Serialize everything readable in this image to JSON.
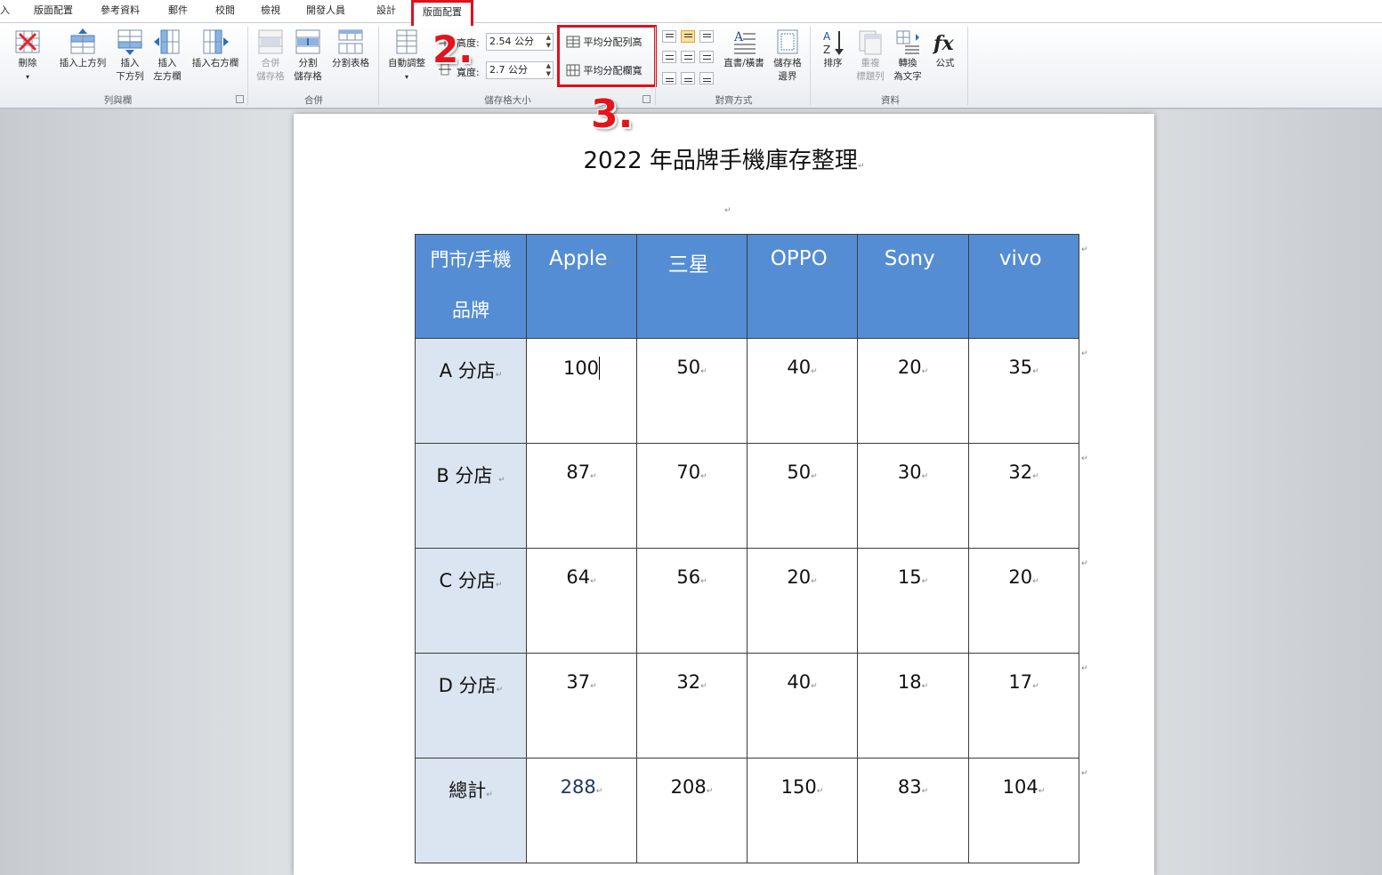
{
  "tabs": [
    {
      "label": "入"
    },
    {
      "label": "版面配置"
    },
    {
      "label": "參考資料"
    },
    {
      "label": "郵件"
    },
    {
      "label": "校閱"
    },
    {
      "label": "檢視"
    },
    {
      "label": "開發人員"
    },
    {
      "label": "設計"
    },
    {
      "label": "版面配置",
      "active": true
    }
  ],
  "ribbon": {
    "rows_cols": {
      "delete": "刪除",
      "insert_above": "插入上方列",
      "insert_below_1": "插入",
      "insert_below_2": "下方列",
      "insert_left_1": "插入",
      "insert_left_2": "左方欄",
      "insert_right": "插入右方欄",
      "label": "列與欄"
    },
    "merge": {
      "merge_cells_1": "合併",
      "merge_cells_2": "儲存格",
      "split_cells_1": "分割",
      "split_cells_2": "儲存格",
      "split_table": "分割表格",
      "label": "合併"
    },
    "cell_size": {
      "autofit": "自動調整",
      "height_label": "高度:",
      "height_value": "2.54 公分",
      "width_label": "寬度:",
      "width_value": "2.7 公分",
      "distribute_rows": "平均分配列高",
      "distribute_cols": "平均分配欄寬",
      "label": "儲存格大小"
    },
    "alignment": {
      "text_direction": "直書/橫書",
      "cell_margins_1": "儲存格",
      "cell_margins_2": "邊界",
      "label": "對齊方式"
    },
    "data": {
      "sort": "排序",
      "repeat_header_1": "重複",
      "repeat_header_2": "標題列",
      "convert_1": "轉換",
      "convert_2": "為文字",
      "formula": "公式",
      "label": "資料"
    }
  },
  "steps": {
    "step2": "2.",
    "step3": "3."
  },
  "document": {
    "title": "2022 年品牌手機庫存整理",
    "para_mark": "↵",
    "header": {
      "first_line1": "門市/手機",
      "first_line2": "品牌",
      "brands": [
        "Apple",
        "三星",
        "OPPO",
        "Sony",
        "vivo"
      ]
    },
    "rows": [
      {
        "store": "A 分店",
        "values": [
          "100",
          "50",
          "40",
          "20",
          "35"
        ]
      },
      {
        "store": "B 分店",
        "values": [
          "87",
          "70",
          "50",
          "30",
          "32"
        ]
      },
      {
        "store": "C 分店",
        "values": [
          "64",
          "56",
          "20",
          "15",
          "20"
        ]
      },
      {
        "store": "D 分店",
        "values": [
          "37",
          "32",
          "40",
          "18",
          "17"
        ]
      },
      {
        "store": "總計",
        "values": [
          "288",
          "208",
          "150",
          "83",
          "104"
        ]
      }
    ]
  }
}
